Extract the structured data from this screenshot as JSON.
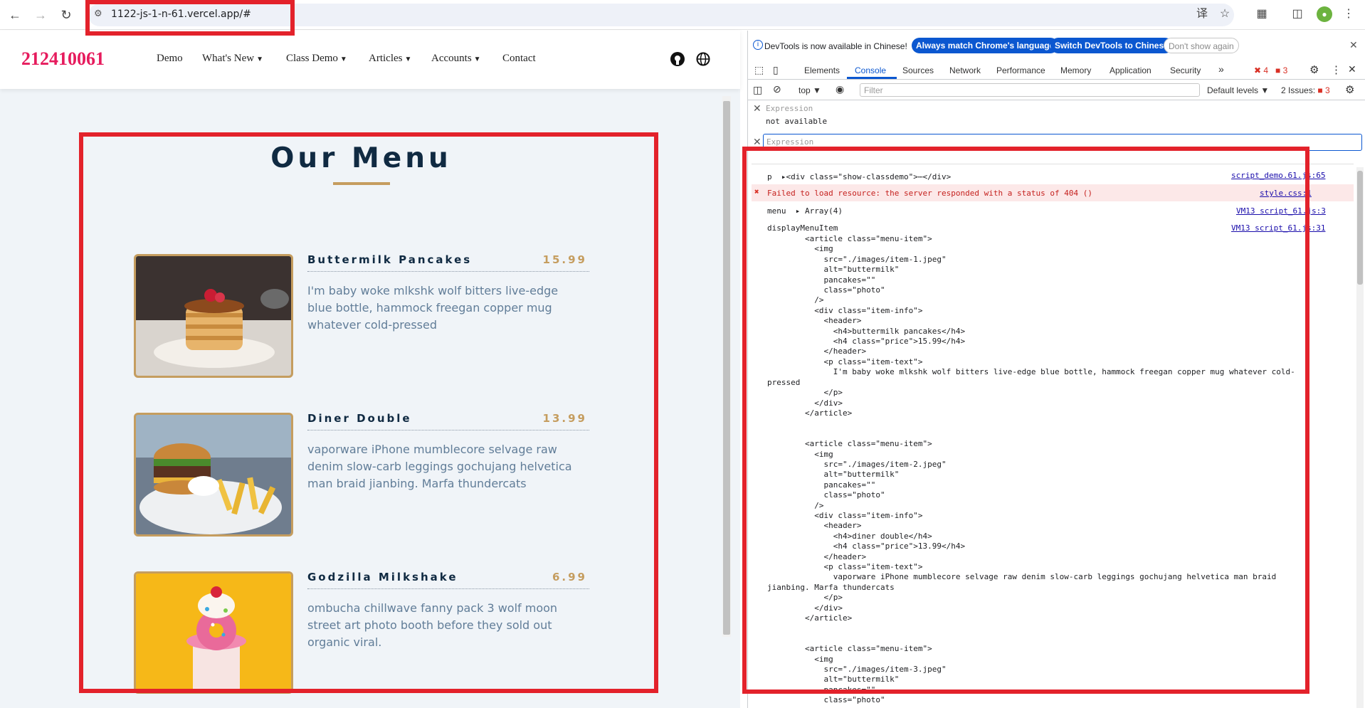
{
  "browser": {
    "url": "1122-js-1-n-61.vercel.app/#"
  },
  "site": {
    "logo": "212410061",
    "nav": [
      {
        "label": "Demo",
        "dropdown": false
      },
      {
        "label": "What's New",
        "dropdown": true
      },
      {
        "label": "Class Demo",
        "dropdown": true
      },
      {
        "label": "Articles",
        "dropdown": true
      },
      {
        "label": "Accounts",
        "dropdown": true
      },
      {
        "label": "Contact",
        "dropdown": false
      }
    ],
    "menu_title": "Our Menu",
    "items": [
      {
        "name": "Buttermilk Pancakes",
        "price": "15.99",
        "text": "I'm baby woke mlkshk wolf bitters live-edge blue bottle, hammock freegan copper mug whatever cold-pressed",
        "image": "pancakes"
      },
      {
        "name": "Diner Double",
        "price": "13.99",
        "text": "vaporware iPhone mumblecore selvage raw denim slow-carb leggings gochujang helvetica man braid jianbing. Marfa thundercats",
        "image": "burger"
      },
      {
        "name": "Godzilla Milkshake",
        "price": "6.99",
        "text": "ombucha chillwave fanny pack 3 wolf moon street art photo booth before they sold out organic viral.",
        "image": "milkshake"
      }
    ]
  },
  "devtools": {
    "info_text": "DevTools is now available in Chinese!",
    "btn_match": "Always match Chrome's language",
    "btn_switch": "Switch DevTools to Chinese",
    "btn_dont": "Don't show again",
    "tabs": [
      "Elements",
      "Console",
      "Sources",
      "Network",
      "Performance",
      "Memory",
      "Application",
      "Security"
    ],
    "active_tab": "Console",
    "error_count": "4",
    "warn_count": "3",
    "context": "top",
    "filter_placeholder": "Filter",
    "levels": "Default levels",
    "issues": "2 Issues:",
    "issues_count": "3",
    "expression_label": "Expression",
    "expression_value": "not available",
    "expression_placeholder": "Expression",
    "logs": [
      {
        "text": "p  ▸<div class=\"show-classdemo\">⋯</div>",
        "source": "script_demo.61.js:65"
      },
      {
        "text": "Failed to load resource: the server responded with a status of 404 ()",
        "source": "style.css:1"
      },
      {
        "text": "menu  ▸ Array(4)",
        "source": "VM13 script_61.js:3"
      },
      {
        "text": "displayMenuItem",
        "source": "VM13 script_61.js:31"
      }
    ],
    "code": "        <article class=\"menu-item\">\n          <img\n            src=\"./images/item-1.jpeg\"\n            alt=\"buttermilk\"\n            pancakes=\"\"\n            class=\"photo\"\n          />\n          <div class=\"item-info\">\n            <header>\n              <h4>buttermilk pancakes</h4>\n              <h4 class=\"price\">15.99</h4>\n            </header>\n            <p class=\"item-text\">\n              I'm baby woke mlkshk wolf bitters live-edge blue bottle, hammock freegan copper mug whatever cold-\npressed\n            </p>\n          </div>\n        </article>\n\n\n        <article class=\"menu-item\">\n          <img\n            src=\"./images/item-2.jpeg\"\n            alt=\"buttermilk\"\n            pancakes=\"\"\n            class=\"photo\"\n          />\n          <div class=\"item-info\">\n            <header>\n              <h4>diner double</h4>\n              <h4 class=\"price\">13.99</h4>\n            </header>\n            <p class=\"item-text\">\n              vaporware iPhone mumblecore selvage raw denim slow-carb leggings gochujang helvetica man braid\njianbing. Marfa thundercats\n            </p>\n          </div>\n        </article>\n\n\n        <article class=\"menu-item\">\n          <img\n            src=\"./images/item-3.jpeg\"\n            alt=\"buttermilk\"\n            pancakes=\"\"\n            class=\"photo\""
  },
  "colors": {
    "annotation_red": "#e3222b",
    "logo_pink": "#e61b5d",
    "gold": "#c59d5f",
    "navy": "#102a42"
  }
}
